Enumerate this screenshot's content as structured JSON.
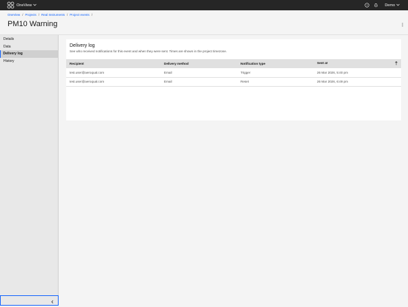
{
  "topbar": {
    "app_name": "OneView",
    "user_name": "Demo"
  },
  "breadcrumb": [
    {
      "label": "OneView"
    },
    {
      "label": "Projects"
    },
    {
      "label": "Real Instruments"
    },
    {
      "label": "Project events"
    }
  ],
  "page": {
    "title": "PM10 Warning"
  },
  "sidebar": {
    "items": [
      {
        "label": "Details",
        "active": false
      },
      {
        "label": "Data",
        "active": false
      },
      {
        "label": "Delivery log",
        "active": true
      },
      {
        "label": "History",
        "active": false
      }
    ]
  },
  "delivery_log": {
    "title": "Delivery log",
    "description": "See who received notifications for this event and when they were sent. Times are shown in the project timezone.",
    "columns": [
      "Recipient",
      "Delivery method",
      "Notification type",
      "Sent at"
    ],
    "rows": [
      {
        "recipient": "test.user@aeroqual.com",
        "method": "Email",
        "type": "Trigger",
        "sent_at": "26 Mar 2026, 5:40 pm"
      },
      {
        "recipient": "test.user@aeroqual.com",
        "method": "Email",
        "type": "Reset",
        "sent_at": "26 Mar 2026, 6:49 pm"
      }
    ]
  },
  "icons": {
    "logo": "app-logo-icon",
    "help": "help-icon",
    "notifications": "bell-icon",
    "overflow": "overflow-menu-icon",
    "sort": "sort-ascending-icon",
    "collapse": "chevron-left-icon"
  },
  "colors": {
    "topbar": "#262626",
    "link": "#0f62fe",
    "active_border": "#0f62fe"
  }
}
